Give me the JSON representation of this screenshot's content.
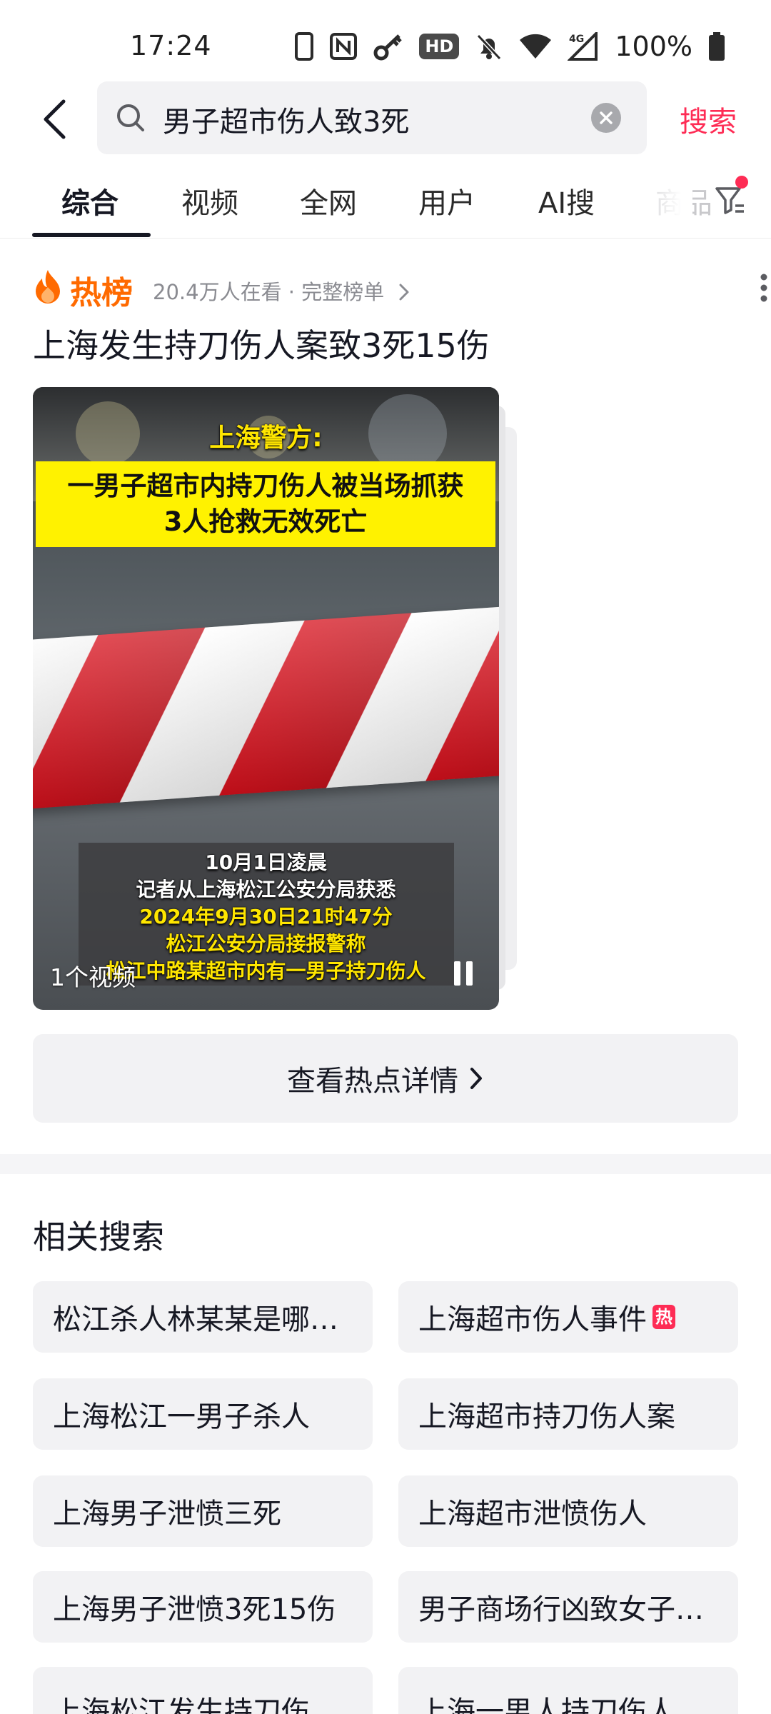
{
  "status_bar": {
    "time": "17:24",
    "hd_label": "HD",
    "network": "4G",
    "battery": "100%"
  },
  "search": {
    "query": "男子超市伤人致3死",
    "submit_label": "搜索"
  },
  "tabs": [
    {
      "label": "综合",
      "active": true
    },
    {
      "label": "视频"
    },
    {
      "label": "全网"
    },
    {
      "label": "用户"
    },
    {
      "label": "AI搜"
    },
    {
      "label": "商品"
    }
  ],
  "hot_card": {
    "label": "热榜",
    "meta": "20.4万人在看 · 完整榜单",
    "title": "上海发生持刀伤人案致3死15伤",
    "video": {
      "heading": "上海警方:",
      "banner_line1": "一男子超市内持刀伤人被当场抓获",
      "banner_line2": "3人抢救无效死亡",
      "captions": [
        {
          "text": "10月1日凌晨",
          "color": "white"
        },
        {
          "text": "记者从上海松江公安分局获悉",
          "color": "white"
        },
        {
          "text": "2024年9月30日21时47分",
          "color": "yellow"
        },
        {
          "text": "松江公安分局接报警称",
          "color": "yellow"
        },
        {
          "text": "松江中路某超市内有一男子持刀伤人",
          "color": "yellow"
        }
      ],
      "count_label": "1个视频"
    },
    "detail_button": "查看热点详情"
  },
  "related": {
    "title": "相关搜索",
    "hot_badge": "热",
    "items": [
      {
        "text": "松江杀人林某某是哪…"
      },
      {
        "text": "上海超市伤人事件",
        "hot": true
      },
      {
        "text": "上海松江一男子杀人"
      },
      {
        "text": "上海超市持刀伤人案"
      },
      {
        "text": "上海男子泄愤三死"
      },
      {
        "text": "上海超市泄愤伤人"
      },
      {
        "text": "上海男子泄愤3死15伤"
      },
      {
        "text": "男子商场行凶致女子…"
      },
      {
        "text": "上海松江发生持刀伤…"
      },
      {
        "text": "上海一男人持刀伤人"
      }
    ]
  },
  "colors": {
    "accent": "#fe2c55",
    "hot_orange": "#ff6a00",
    "chip_bg": "#f2f2f4",
    "text_primary": "#161823",
    "text_secondary": "#8a8b91"
  }
}
